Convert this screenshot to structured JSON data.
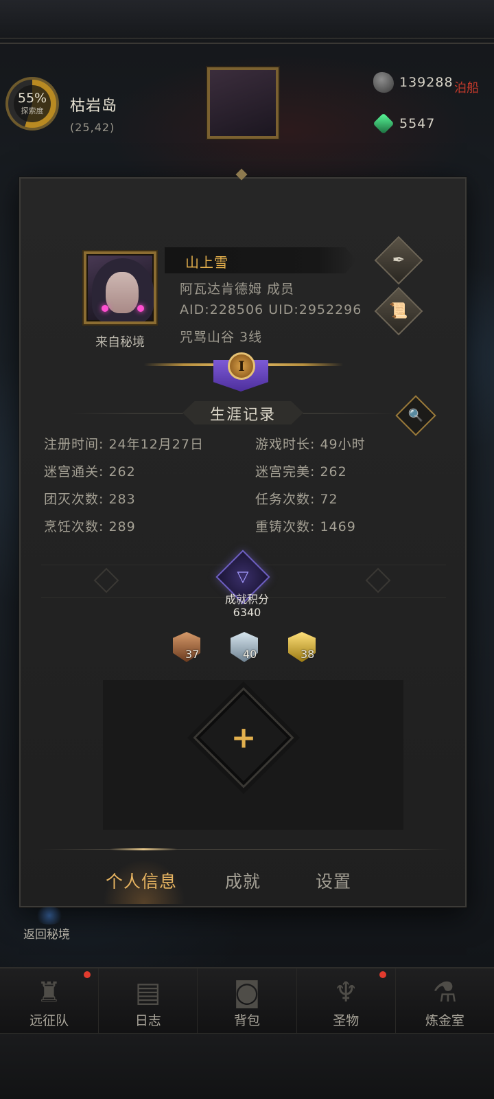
{
  "hud": {
    "explore_percent": "55%",
    "explore_label": "探索度",
    "region_name": "枯岩岛",
    "region_coord": "(25,42)",
    "resource_1": "139288",
    "resource_2": "5547",
    "bg_text": "泊船"
  },
  "profile": {
    "name": "山上雪",
    "guild_line": "阿瓦达肯德姆  成员",
    "id_line": "AID:228506 UID:2952296",
    "server_line": "咒骂山谷  3线",
    "avatar_caption": "来自秘境",
    "rank_numeral": "I"
  },
  "career": {
    "title": "生涯记录",
    "stats": [
      "注册时间: 24年12月27日",
      "游戏时长: 49小时",
      "迷宫通关: 262",
      "迷宫完美: 262",
      "团灭次数: 283",
      "任务次数: 72",
      "烹饪次数: 289",
      "重铸次数: 1469"
    ]
  },
  "achievement": {
    "label": "成就积分",
    "score": "6340",
    "bronze": "37",
    "silver": "40",
    "gold": "38"
  },
  "tabs": [
    "个人信息",
    "成就",
    "设置"
  ],
  "return_label": "返回秘境",
  "bottom_nav": [
    "远征队",
    "日志",
    "背包",
    "圣物",
    "炼金室"
  ],
  "icons": {
    "quill": "✒",
    "scroll": "📜",
    "search": "🔍",
    "plus": "+",
    "achievement": "▽"
  },
  "colors": {
    "accent_gold": "#e2ae4c",
    "tab_active": "#e7b461",
    "alert_red": "#e23b2e"
  }
}
